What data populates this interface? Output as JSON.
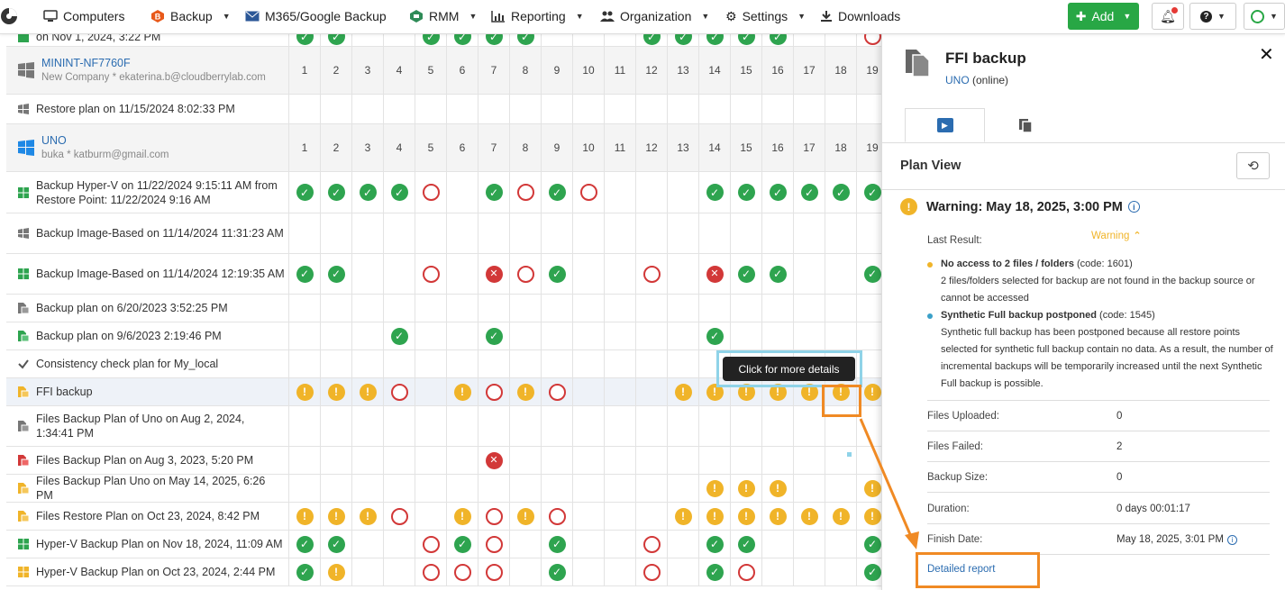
{
  "nav": {
    "items": [
      {
        "label": "Computers",
        "icon": "monitor-icon",
        "caret": false
      },
      {
        "label": "Backup",
        "icon": "backup-icon",
        "caret": true
      },
      {
        "label": "M365/Google Backup",
        "icon": "mail-icon",
        "caret": false
      },
      {
        "label": "RMM",
        "icon": "rmm-icon",
        "caret": true
      },
      {
        "label": "Reporting",
        "icon": "chart-icon",
        "caret": true
      },
      {
        "label": "Organization",
        "icon": "users-icon",
        "caret": true
      },
      {
        "label": "Settings",
        "icon": "gear-icon",
        "caret": true
      },
      {
        "label": "Downloads",
        "icon": "download-icon",
        "caret": false
      }
    ],
    "add_label": "Add"
  },
  "grid": {
    "rows": [
      {
        "type": "plan",
        "name": "on Nov 1, 2024, 3:22 PM",
        "icon": "green",
        "cells": {
          "1": "ok",
          "2": "ok",
          "5": "ok",
          "6": "ok",
          "7": "ok",
          "8": "ok",
          "12": "ok",
          "13": "ok",
          "14": "ok",
          "15": "ok",
          "16": "ok",
          "19": "fail"
        }
      },
      {
        "type": "computer",
        "name": "MININT-NF7760F",
        "sub": "New Company * ekaterina.b@cloudberrylab.com",
        "os": "windows-gray",
        "days": [
          "1",
          "2",
          "3",
          "4",
          "5",
          "6",
          "7",
          "8",
          "9",
          "10",
          "11",
          "12",
          "13",
          "14",
          "15",
          "16",
          "17",
          "18",
          "19"
        ]
      },
      {
        "type": "plan",
        "name": "Restore plan on 11/15/2024 8:02:33 PM",
        "icon": "gray-win",
        "cells": {}
      },
      {
        "type": "computer",
        "name": "UNO",
        "sub": "buka * katburm@gmail.com",
        "os": "windows-blue",
        "days": [
          "1",
          "2",
          "3",
          "4",
          "5",
          "6",
          "7",
          "8",
          "9",
          "10",
          "11",
          "12",
          "13",
          "14",
          "15",
          "16",
          "17",
          "18",
          "19"
        ]
      },
      {
        "type": "plan",
        "name": "Backup Hyper-V on 11/22/2024 9:15:11 AM from Restore Point: 11/22/2024 9:16 AM",
        "icon": "green-win",
        "cells": {
          "1": "ok",
          "2": "ok",
          "3": "ok",
          "4": "ok",
          "5": "fail",
          "7": "ok",
          "8": "fail",
          "9": "ok",
          "10": "fail",
          "14": "ok",
          "15": "ok",
          "16": "ok",
          "17": "ok",
          "18": "ok",
          "19": "ok"
        }
      },
      {
        "type": "plan",
        "name": "Backup Image-Based on 11/14/2024 11:31:23 AM",
        "icon": "gray-win",
        "cells": {}
      },
      {
        "type": "plan",
        "name": "Backup Image-Based on 11/14/2024 12:19:35 AM",
        "icon": "green-win",
        "cells": {
          "1": "ok",
          "2": "ok",
          "5": "fail",
          "7": "err",
          "8": "fail",
          "9": "ok",
          "12": "fail",
          "14": "err",
          "15": "ok",
          "16": "ok",
          "19": "ok"
        }
      },
      {
        "type": "plan",
        "name": "Backup plan on 6/20/2023 3:52:25 PM",
        "icon": "gray-file",
        "cells": {}
      },
      {
        "type": "plan",
        "name": "Backup plan on 9/6/2023 2:19:46 PM",
        "icon": "green-file",
        "cells": {
          "4": "ok",
          "7": "ok",
          "14": "ok"
        }
      },
      {
        "type": "plan",
        "name": "Consistency check plan for My_local",
        "icon": "check",
        "cells": {}
      },
      {
        "type": "plan",
        "name": "FFI backup",
        "icon": "yellow-folder",
        "selected": true,
        "cells": {
          "1": "warn",
          "2": "warn",
          "3": "warn",
          "4": "fail",
          "6": "warn",
          "7": "fail",
          "8": "warn",
          "9": "fail",
          "13": "warn",
          "14": "warn",
          "15": "warn",
          "16": "warn",
          "17": "warn",
          "18": "warn",
          "19": "warn"
        }
      },
      {
        "type": "plan",
        "name": "Files Backup Plan of Uno on Aug 2, 2024, 1:34:41 PM",
        "icon": "gray-file",
        "cells": {}
      },
      {
        "type": "plan",
        "name": "Files Backup Plan on Aug 3, 2023, 5:20 PM",
        "icon": "red-file",
        "cells": {
          "7": "err"
        }
      },
      {
        "type": "plan",
        "name": "Files Backup Plan Uno on May 14, 2025, 6:26 PM",
        "icon": "yellow-folder",
        "cells": {
          "14": "warn",
          "15": "warn",
          "16": "warn",
          "19": "warn"
        }
      },
      {
        "type": "plan",
        "name": "Files Restore Plan on Oct 23, 2024, 8:42 PM",
        "icon": "yellow-folder",
        "cells": {
          "1": "warn",
          "2": "warn",
          "3": "warn",
          "4": "fail",
          "6": "warn",
          "7": "fail",
          "8": "warn",
          "9": "fail",
          "13": "warn",
          "14": "warn",
          "15": "warn",
          "16": "warn",
          "17": "warn",
          "18": "warn",
          "19": "warn"
        }
      },
      {
        "type": "plan",
        "name": "Hyper-V Backup Plan on Nov 18, 2024, 11:09 AM",
        "icon": "green-win",
        "cells": {
          "1": "ok",
          "2": "ok",
          "5": "fail",
          "6": "ok",
          "7": "fail",
          "9": "ok",
          "12": "fail",
          "14": "ok",
          "15": "ok",
          "19": "ok"
        }
      },
      {
        "type": "plan",
        "name": "Hyper-V Backup Plan on Oct 23, 2024, 2:44 PM",
        "icon": "yellow-win",
        "cells": {
          "1": "ok",
          "2": "warn",
          "5": "fail",
          "6": "fail",
          "7": "fail",
          "9": "ok",
          "12": "fail",
          "14": "ok",
          "15": "fail",
          "19": "ok"
        }
      }
    ]
  },
  "tooltip": {
    "text": "Click for more details"
  },
  "panel": {
    "title": "FFI backup",
    "computer": "UNO",
    "status": "(online)",
    "plan_view_label": "Plan View",
    "warning_heading": "Warning: May 18, 2025, 3:00 PM",
    "last_result_label": "Last Result:",
    "last_result_value": "Warning",
    "messages": [
      {
        "title": "No access to 2 files / folders",
        "code": "(code: 1601)",
        "text": "2 files/folders selected for backup are not found in the backup source or cannot be accessed",
        "color": "#f0b429"
      },
      {
        "title": "Synthetic Full backup postponed",
        "code": "(code: 1545)",
        "text": "Synthetic full backup has been postponed because all restore points selected for synthetic full backup contain no data. As a result, the number of incremental backups will be temporarily increased until the next Synthetic Full backup is possible.",
        "color": "#3aa0c8"
      }
    ],
    "stats": [
      {
        "label": "Files Uploaded:",
        "value": "0"
      },
      {
        "label": "Files Failed:",
        "value": "2"
      },
      {
        "label": "Backup Size:",
        "value": "0"
      },
      {
        "label": "Duration:",
        "value": "0 days 00:01:17"
      },
      {
        "label": "Finish Date:",
        "value": "May 18, 2025, 3:01 PM"
      }
    ],
    "report_link": "Detailed report"
  },
  "colors": {
    "ok": "#2ea44f",
    "fail": "#d23838",
    "warn": "#f0b429",
    "accent": "#f08a24",
    "link": "#2b6cb0"
  }
}
